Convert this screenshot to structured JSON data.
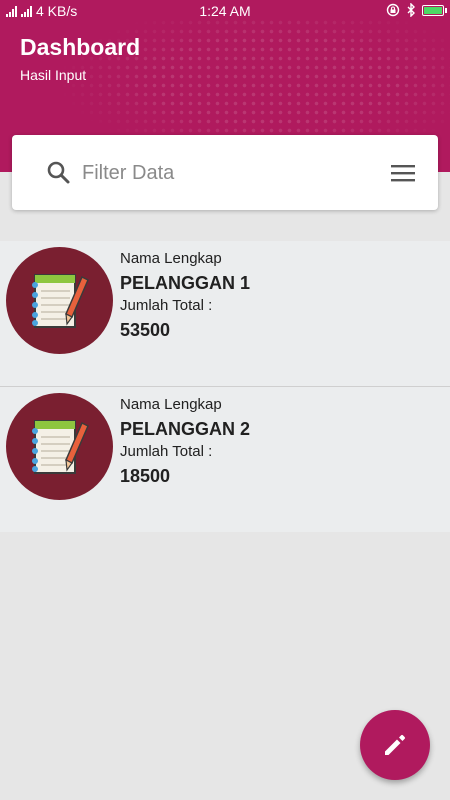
{
  "status_bar": {
    "network_speed": "4 KB/s",
    "time": "1:24 AM"
  },
  "header": {
    "title": "Dashboard",
    "subtitle": "Hasil Input"
  },
  "search": {
    "placeholder": "Filter Data"
  },
  "items": [
    {
      "name_label": "Nama Lengkap",
      "name": "PELANGGAN 1",
      "total_label": "Jumlah Total :",
      "total": "53500"
    },
    {
      "name_label": "Nama Lengkap",
      "name": "PELANGGAN 2",
      "total_label": "Jumlah Total :",
      "total": "18500"
    }
  ],
  "colors": {
    "primary": "#b01a5e",
    "list_background": "#ebedee",
    "avatar_background": "#7a1f30"
  },
  "icons": {
    "search": "search-icon",
    "menu": "menu-icon",
    "fab": "edit-pencil-icon",
    "avatar": "notebook-pencil-icon"
  }
}
